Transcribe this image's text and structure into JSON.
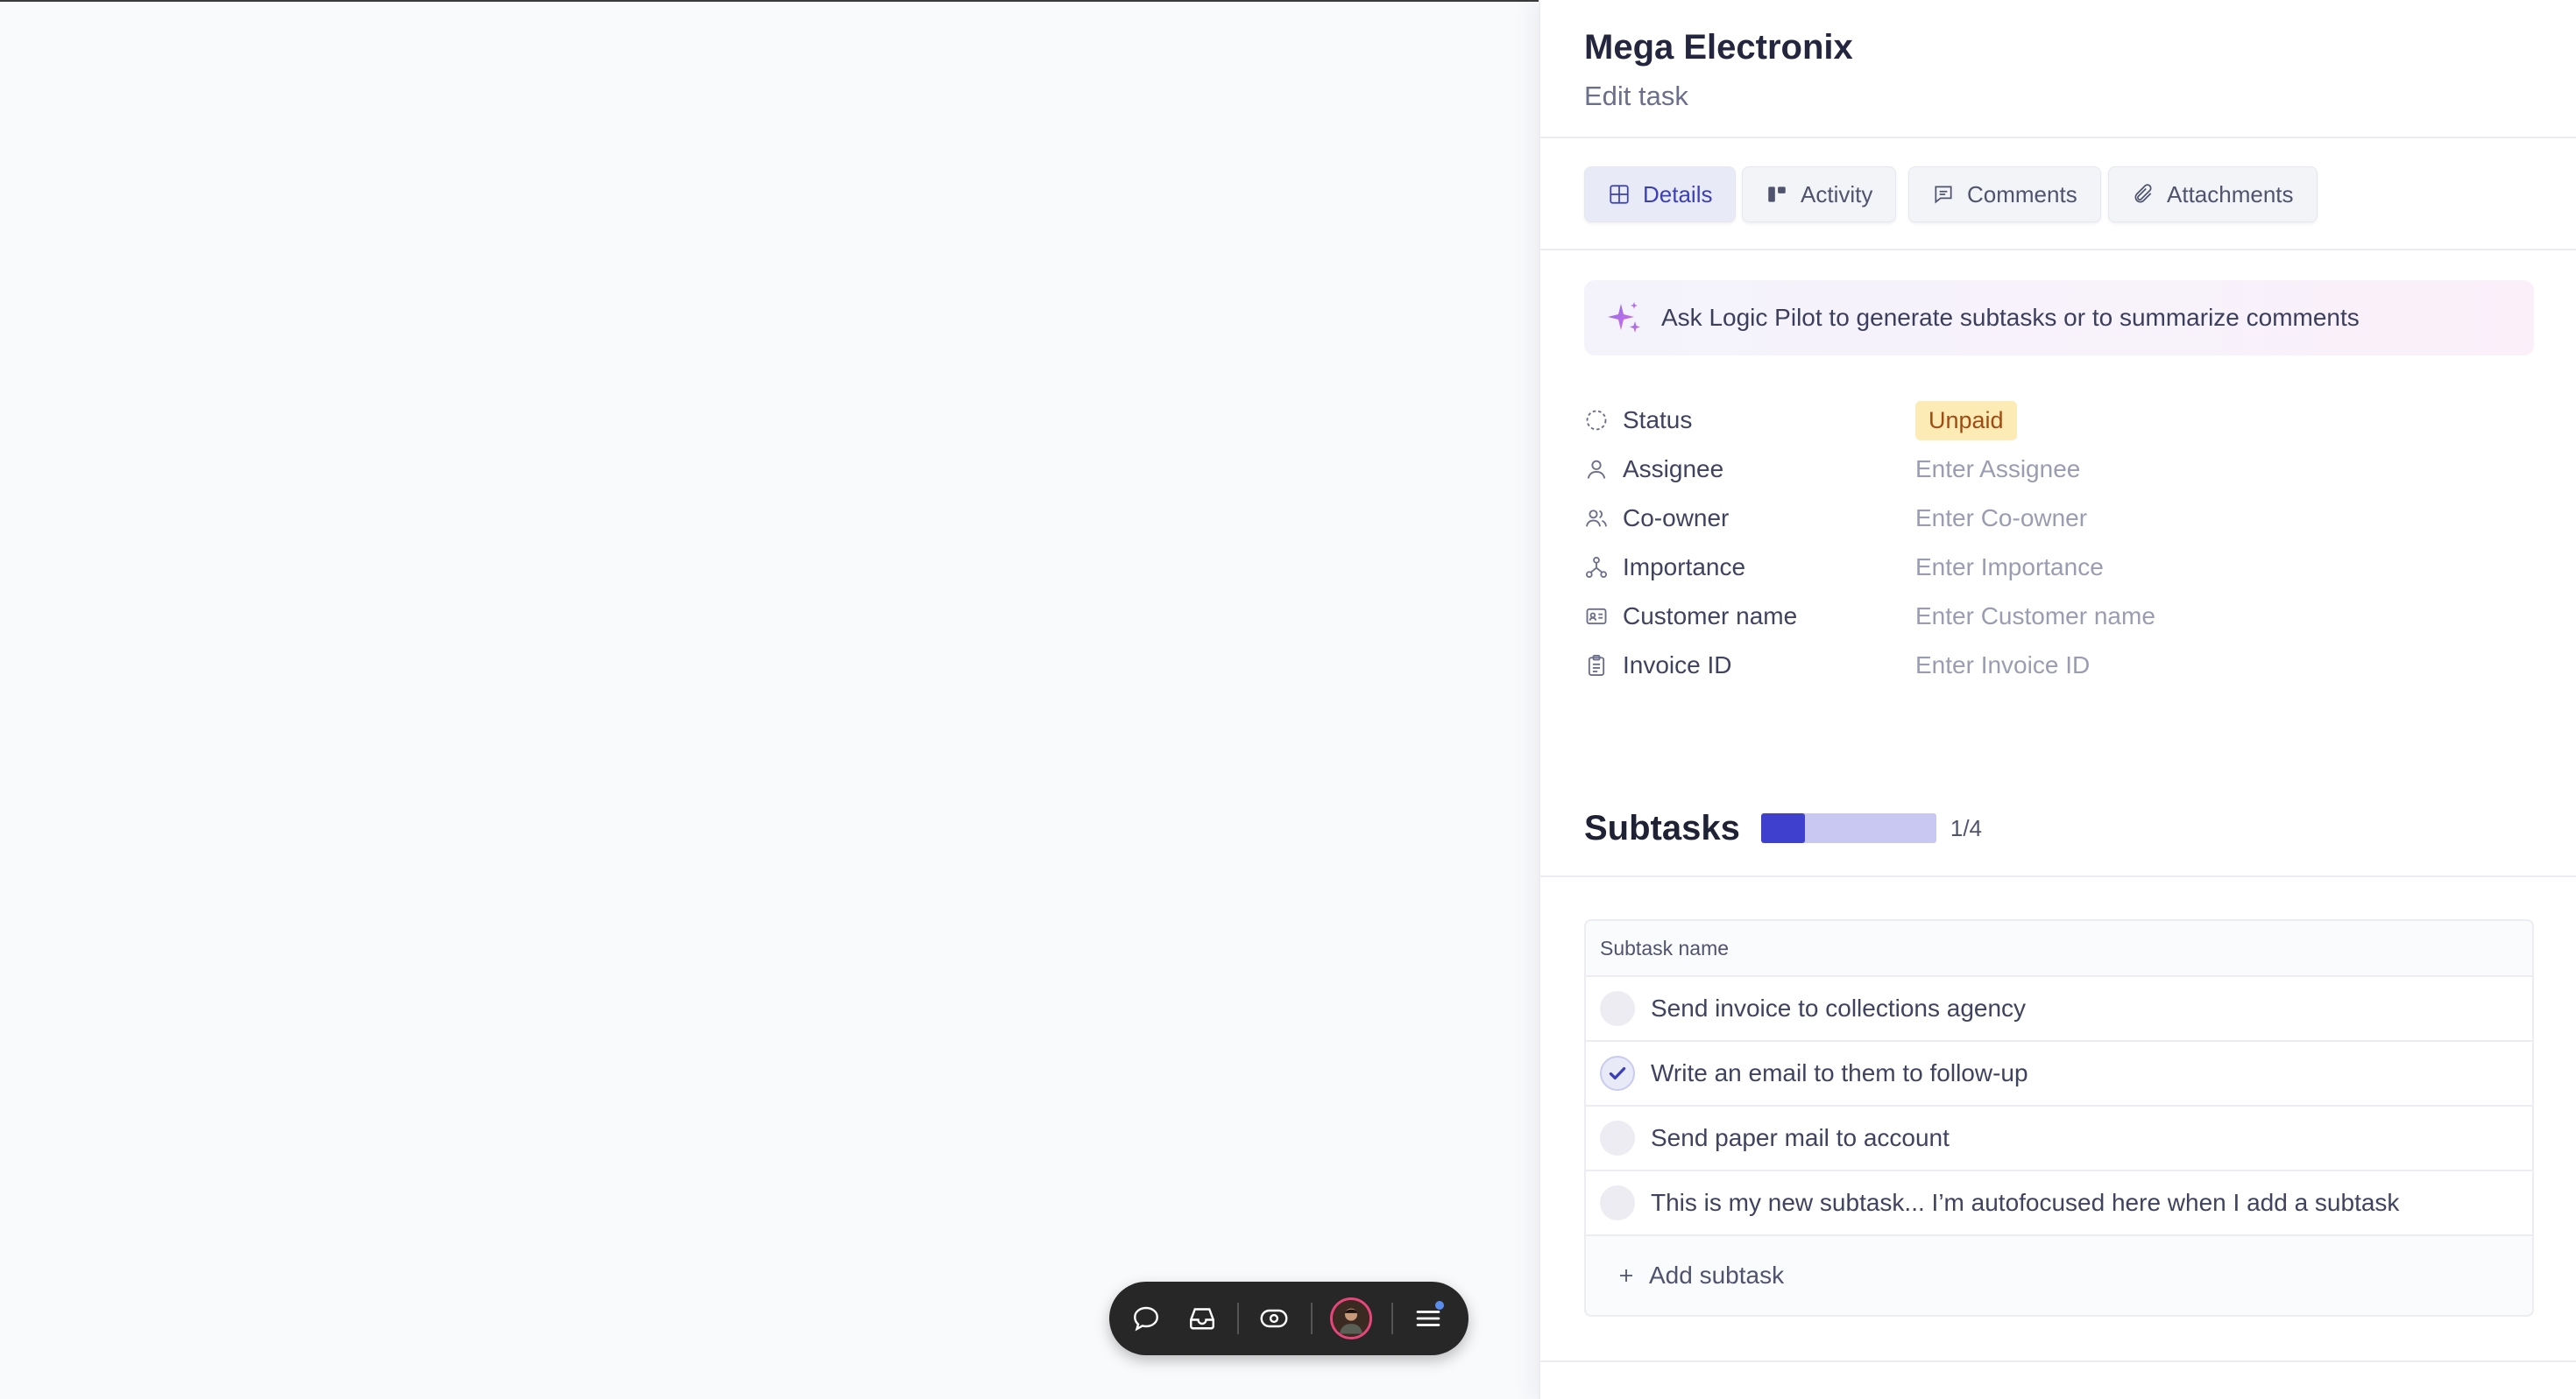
{
  "panel": {
    "title": "Mega Electronix",
    "subtitle": "Edit task"
  },
  "tabs": [
    {
      "label": "Details",
      "icon": "grid-icon",
      "active": true
    },
    {
      "label": "Activity",
      "icon": "activity-icon",
      "active": false
    },
    {
      "label": "Comments",
      "icon": "comment-icon",
      "active": false
    },
    {
      "label": "Attachments",
      "icon": "paperclip-icon",
      "active": false
    }
  ],
  "ai_banner": {
    "text": "Ask Logic Pilot to generate subtasks or to summarize comments",
    "icon": "sparkle-icon"
  },
  "fields": [
    {
      "label": "Status",
      "icon": "status-icon",
      "value": "Unpaid"
    },
    {
      "label": "Assignee",
      "icon": "user-icon",
      "placeholder": "Enter Assignee"
    },
    {
      "label": "Co-owner",
      "icon": "users-icon",
      "placeholder": "Enter Co-owner"
    },
    {
      "label": "Importance",
      "icon": "network-icon",
      "placeholder": "Enter Importance"
    },
    {
      "label": "Customer name",
      "icon": "id-card-icon",
      "placeholder": "Enter Customer name"
    },
    {
      "label": "Invoice ID",
      "icon": "clipboard-icon",
      "placeholder": "Enter Invoice ID"
    }
  ],
  "subtasks": {
    "title": "Subtasks",
    "completed": 1,
    "total": 4,
    "count_label": "1/4",
    "column_header": "Subtask name",
    "items": [
      {
        "name": "Send invoice to collections agency",
        "done": false
      },
      {
        "name": "Write an email to them to follow-up",
        "done": true
      },
      {
        "name": "Send paper mail to account",
        "done": false
      },
      {
        "name": "This is my new subtask... I’m autofocused here when I add a subtask",
        "done": false
      }
    ],
    "add_label": "Add subtask"
  },
  "dock": {
    "icons": [
      "chat-icon",
      "inbox-icon",
      "eye-icon",
      "avatar",
      "menu-icon"
    ]
  },
  "colors": {
    "accent": "#4040cf",
    "progress_track": "#c9c8f2",
    "status_bg": "#fdebb5",
    "status_text": "#a14a12"
  }
}
